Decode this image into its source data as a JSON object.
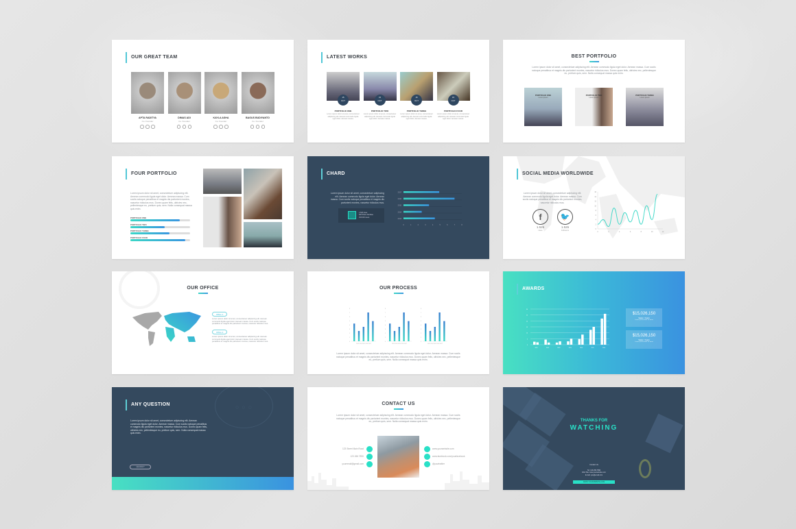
{
  "slides": {
    "team": {
      "title": "OUR GREAT TEAM",
      "members": [
        {
          "name": "APTA RADITYA",
          "role": "Co. Founder"
        },
        {
          "name": "DIMAS ADI",
          "role": "Co. Founder"
        },
        {
          "name": "KAYLA ASHA",
          "role": "Co. Founder"
        },
        {
          "name": "BAGUS BUDIYANTO",
          "role": "Co. Founder"
        }
      ],
      "social_icons": [
        "facebook-icon",
        "google-plus-icon",
        "linkedin-icon"
      ]
    },
    "latest_works": {
      "title": "LATEST WORKS",
      "items": [
        {
          "label": "PORTFOLIO ONE",
          "badge_day": "15",
          "badge_month": "OCT",
          "desc": "Lorem ipsum dolor sit amet, consectetuer adipiscing elit. Aenean commodo ligula eget dolor. Aenean massa."
        },
        {
          "label": "PORTFOLIO TWO",
          "badge_day": "15",
          "badge_month": "OCT",
          "desc": "Lorem ipsum dolor sit amet, consectetuer adipiscing elit. Aenean commodo ligula eget dolor. Aenean massa."
        },
        {
          "label": "PORTFOLIO THREE",
          "badge_day": "15",
          "badge_month": "OCT",
          "desc": "Lorem ipsum dolor sit amet, consectetuer adipiscing elit. Aenean commodo ligula eget dolor. Aenean massa."
        },
        {
          "label": "PORTFOLIO FOUR",
          "badge_day": "15",
          "badge_month": "OCT",
          "desc": "Lorem ipsum dolor sit amet, consectetuer adipiscing elit. Aenean commodo ligula eget dolor. Aenean massa."
        }
      ]
    },
    "best_portfolio": {
      "title": "BEST PORTFOLIO",
      "text": "Lorem ipsum dolor sit amet, consectetuer adipiscing elit. Aenean commodo ligula eget dolor. Aenean massa. Cum sociis natoque penatibus et magnis dis parturient montes, nascetur ridiculus mus. Donec quam felis, ultricies nec, pellentesque eu, pretium quis, sem. Nulla consequat massa quis enim.",
      "items": [
        {
          "label": "PORTFOLIO ONE",
          "sub": "Lorem Ipsum"
        },
        {
          "label": "PORTFOLIO TWO",
          "sub": "Lorem Ipsum"
        },
        {
          "label": "PORTFOLIO THREE",
          "sub": "Lorem Ipsum"
        }
      ]
    },
    "four_portfolio": {
      "title": "FOUR PORTFOLIO",
      "text": "Lorem ipsum dolor sit amet, consectetuer adipiscing elit. Aenean commodo ligula eget dolor. Aenean massa. Cum sociis natoque penatibus et magnis dis parturient montes, nascetur ridiculus mus. Donec quam felis, ultricies nec, pellentesque eu, pretium quis, sem. Nulla consequat massa quis enim.",
      "bars": [
        {
          "label": "PORTFOLIO ONE",
          "percent": 83
        },
        {
          "label": "PORTFOLIO TWO",
          "percent": 57
        },
        {
          "label": "PORTFOLIO THREE",
          "percent": 66
        },
        {
          "label": "PORTFOLIO FOUR",
          "percent": 92
        }
      ]
    },
    "chard": {
      "title": "CHARD",
      "text": "Lorem ipsum dolor sit amet, consectetuer adipiscing elit. Aenean commodo ligula eget dolor. Aenean massa. Cum sociis natoque penatibus et magnis dis parturient montes, nascetur ridiculus mus.",
      "stat_lines": [
        "1.526 Likes",
        "526 Share Fanbase",
        "153.600 views"
      ]
    },
    "social": {
      "title": "SOCIAL MEDIA WORLDWIDE",
      "text": "Lorem ipsum dolor sit amet, consectetuer adipiscing elit. Aenean commodo ligula eget dolor. Aenean massa. Cum sociis natoque penatibus et magnis dis parturient montes, nascetur ridiculus mus.",
      "facebook": {
        "value": "1.526",
        "label": "Likes"
      },
      "twitter": {
        "value": "1.526",
        "label": "Followers"
      }
    },
    "office": {
      "title": "OUR OFFICE",
      "offices": [
        {
          "tag": "Office 1",
          "text": "Lorem ipsum dolor sit amet, consectetuer adipiscing elit. Aenean commodo ligula eget dolor. Aenean massa. Cum sociis natoque penatibus et magnis dis parturient montes, nascetur ridiculus mus."
        },
        {
          "tag": "Office 2",
          "text": "Lorem ipsum dolor sit amet, consectetuer adipiscing elit. Aenean commodo ligula eget dolor. Aenean massa. Cum sociis natoque penatibus et magnis dis parturient montes, nascetur ridiculus mus."
        }
      ]
    },
    "process": {
      "title": "OUR PROCESS",
      "text": "Lorem ipsum dolor sit amet, consectetuer adipiscing elit. Aenean commodo ligula eget dolor. Aenean massa. Cum sociis natoque penatibus et magnis dis parturient montes, nascetur ridiculus mus. Donec quam felis, ultricies nec, pellentesque eu, pretium quis, sem. Nulla consequat massa quis enim."
    },
    "awards": {
      "title": "AWARDS",
      "boxes": [
        {
          "value": "$15,026,150",
          "label": "Sales / Years",
          "desc": "Lorem ipsum dolor sit amet"
        },
        {
          "value": "$15,026,150",
          "label": "Sales / Years",
          "desc": "Lorem ipsum dolor sit amet"
        }
      ]
    },
    "question": {
      "title": "ANY QUESTION",
      "text": "Lorem ipsum dolor sit amet, consectetuer adipiscing elit. Aenean commodo ligula eget dolor. Aenean massa. Cum sociis natoque penatibus et magnis dis parturient montes, nascetur ridiculus mus. Donec quam felis, ultricies nec, pellentesque eu, pretium quis, sem. Nulla consequat massa quis enim.",
      "button": "Question?"
    },
    "contact": {
      "title": "CONTACT US",
      "text": "Lorem ipsum dolor sit amet, consectetuer adipiscing elit. Aenean commodo ligula eget dolor. Aenean massa. Cum sociis natoque penatibus et magnis dis parturient montes, nascetur ridiculus mus. Donec quam felis, ultricies nec, pellentesque eu, pretium quis, sem. Nulla consequat massa quis enim.",
      "left": [
        "123 Street Main Road",
        "123 456 7890",
        "youremail@gmail.com"
      ],
      "right": [
        "www.yourwebsite.com",
        "www.facebook.com/yourfacebook",
        "@yourtwitter"
      ]
    },
    "thanks": {
      "line1": "THANKS FOR",
      "line2": "WATCHING",
      "contact_label": "Contact Us",
      "lines": [
        "Tel: 123-456-7890",
        "Web Site: www.yourwebsite.com",
        "E-mail: you@email.com"
      ],
      "url_bar": "WWW.YOURWEBSITE.COM"
    }
  },
  "colors": {
    "accent_teal": "#3ad7c6",
    "accent_blue": "#3a96e0",
    "dark_slide": "#34495e",
    "bright_teal": "#29e0c7"
  },
  "chart_data": [
    {
      "id": "chard",
      "type": "bar",
      "orientation": "horizontal",
      "categories": [
        "2017",
        "2016",
        "2015",
        "2014",
        "2013"
      ],
      "values": [
        4.9,
        7,
        3.5,
        2.5,
        4.3
      ],
      "xlim": [
        0,
        8
      ],
      "xticks": [
        0,
        1,
        2,
        3,
        4,
        5,
        6,
        7,
        8
      ]
    },
    {
      "id": "social",
      "type": "line",
      "x": [
        0,
        1,
        2,
        3,
        4,
        5,
        6,
        7,
        8,
        9,
        10,
        11
      ],
      "values": [
        2,
        4,
        1,
        9,
        2,
        7,
        3,
        8,
        2,
        10,
        4,
        15
      ],
      "xlim": [
        0,
        12
      ],
      "ylim": [
        0,
        16
      ],
      "xticks": [
        0,
        2,
        4,
        6,
        8,
        10,
        12
      ],
      "yticks": [
        0,
        2,
        4,
        6,
        8,
        10,
        12,
        14,
        16
      ]
    },
    {
      "id": "process",
      "type": "bar",
      "repeat": 3,
      "categories": [
        "2013",
        "2014",
        "2015",
        "2016",
        "2017"
      ],
      "values": [
        4.3,
        2.5,
        3.5,
        7,
        4.9
      ],
      "ylim": [
        0,
        8
      ]
    },
    {
      "id": "awards",
      "type": "bar",
      "categories": [
        "2012",
        "2013",
        "2013",
        "2013",
        "2014",
        "2015",
        "2016"
      ],
      "series": [
        {
          "name": "A",
          "values": [
            2.5,
            4.3,
            1.8,
            2.8,
            4.8,
            12.5,
            22
          ]
        },
        {
          "name": "B",
          "values": [
            2,
            1.8,
            2.8,
            5,
            8.5,
            15,
            26
          ]
        }
      ],
      "ylim": [
        0,
        30
      ],
      "yticks": [
        0,
        5,
        10,
        15,
        20,
        25,
        30
      ]
    }
  ]
}
